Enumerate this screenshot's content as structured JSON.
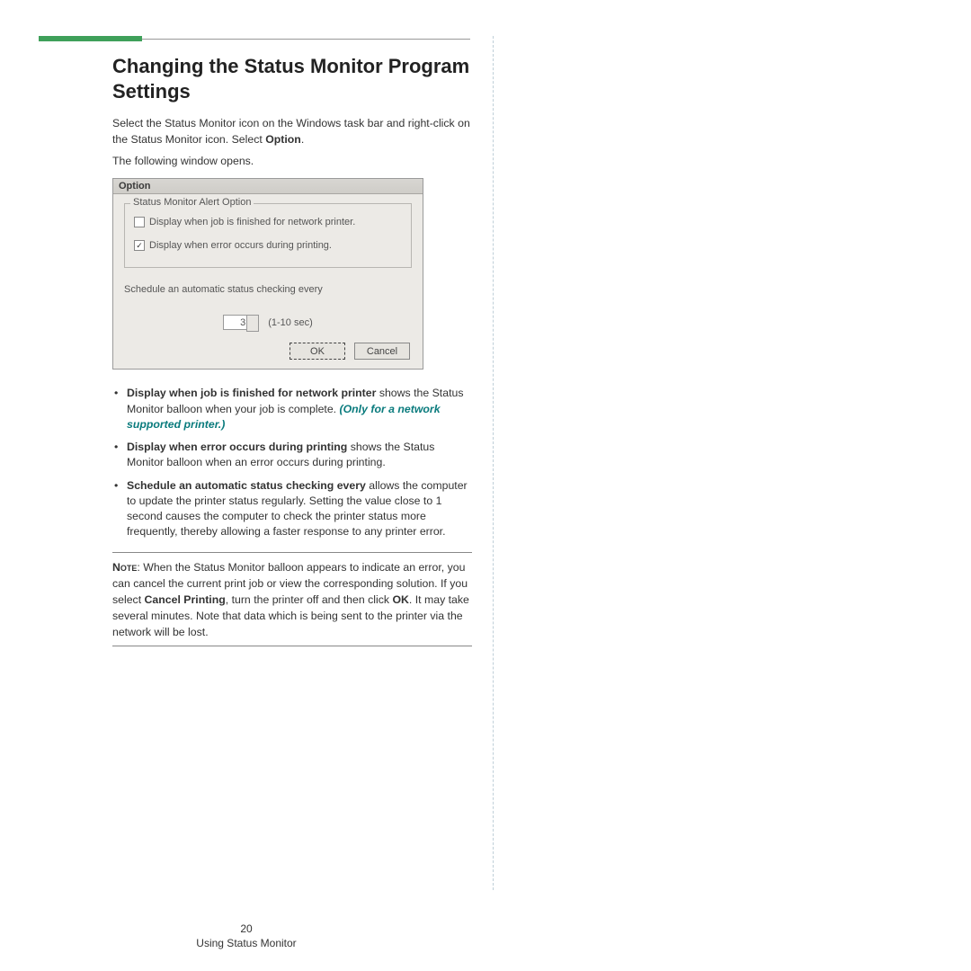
{
  "heading": "Changing the Status Monitor Program Settings",
  "intro_a": "Select the Status Monitor icon on the Windows task bar and right-click on the Status Monitor icon. Select ",
  "intro_bold": "Option",
  "intro_b": ".",
  "intro2": "The following window opens.",
  "dialog": {
    "title": "Option",
    "group_legend": "Status Monitor Alert Option",
    "chk1_checked": false,
    "chk1_label": "Display when job is finished for network printer.",
    "chk2_checked": true,
    "chk2_label": "Display when error occurs during printing.",
    "sched_label": "Schedule an automatic status checking every",
    "spinner_value": "3",
    "spinner_suffix": "(1-10 sec)",
    "ok": "OK",
    "cancel": "Cancel"
  },
  "bullets": {
    "b1_bold": "Display when job is finished for network printer",
    "b1_rest": " shows the Status Monitor balloon when your job is complete. ",
    "b1_teal": "(Only for a network supported printer.)",
    "b2_bold": "Display when error occurs during printing",
    "b2_rest": " shows the Status Monitor balloon when an error occurs during printing.",
    "b3_bold": "Schedule an automatic status checking every",
    "b3_rest": " allows the computer to update the printer status regularly. Setting the value close to 1 second causes the computer to check the printer status more frequently, thereby allowing a faster response to any printer error."
  },
  "note": {
    "lead": "Note",
    "a": ": When the Status Monitor balloon appears to indicate an error, you can cancel the current print job or view the corresponding solution. If you select ",
    "bold1": "Cancel Printing",
    "b": ", turn the printer off and then click ",
    "bold2": "OK",
    "c": ". It may take several minutes. Note that data which is being sent to the printer via the network will be lost."
  },
  "footer": {
    "page": "20",
    "section": "Using Status Monitor"
  }
}
